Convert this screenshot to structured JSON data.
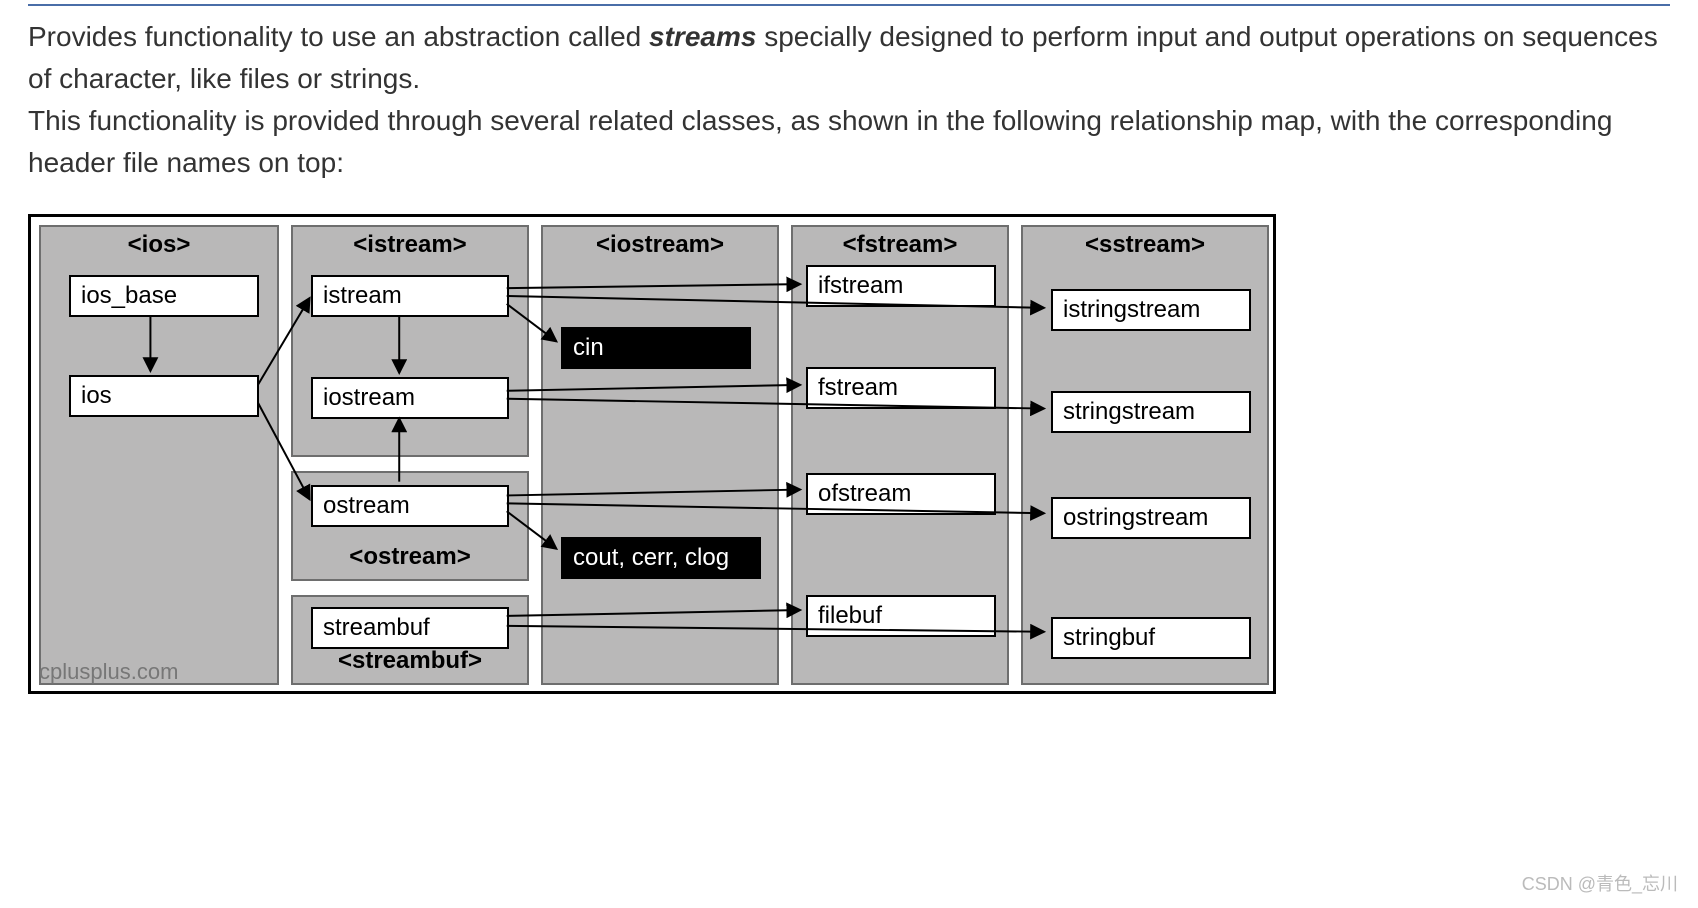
{
  "intro": {
    "p1_a": "Provides functionality to use an abstraction called ",
    "p1_em": "streams",
    "p1_b": " specially designed to perform input and output operations on sequences of character, like files or strings.",
    "p2": "This functionality is provided through several related classes, as shown in the following relationship map, with the corresponding header file names on top:"
  },
  "columns": {
    "ios": "<ios>",
    "istream": "<istream>",
    "ostream": "<ostream>",
    "streambuf": "<streambuf>",
    "iostream": "<iostream>",
    "fstream": "<fstream>",
    "sstream": "<sstream>"
  },
  "boxes": {
    "ios_base": "ios_base",
    "ios": "ios",
    "istream": "istream",
    "iostream_cls": "iostream",
    "ostream": "ostream",
    "streambuf": "streambuf",
    "cin": "cin",
    "cout": "cout, cerr, clog",
    "ifstream": "ifstream",
    "fstream_cls": "fstream",
    "ofstream": "ofstream",
    "filebuf": "filebuf",
    "istringstream": "istringstream",
    "stringstream": "stringstream",
    "ostringstream": "ostringstream",
    "stringbuf": "stringbuf"
  },
  "watermark": "cplusplus.com",
  "csdn": "CSDN @青色_忘川"
}
